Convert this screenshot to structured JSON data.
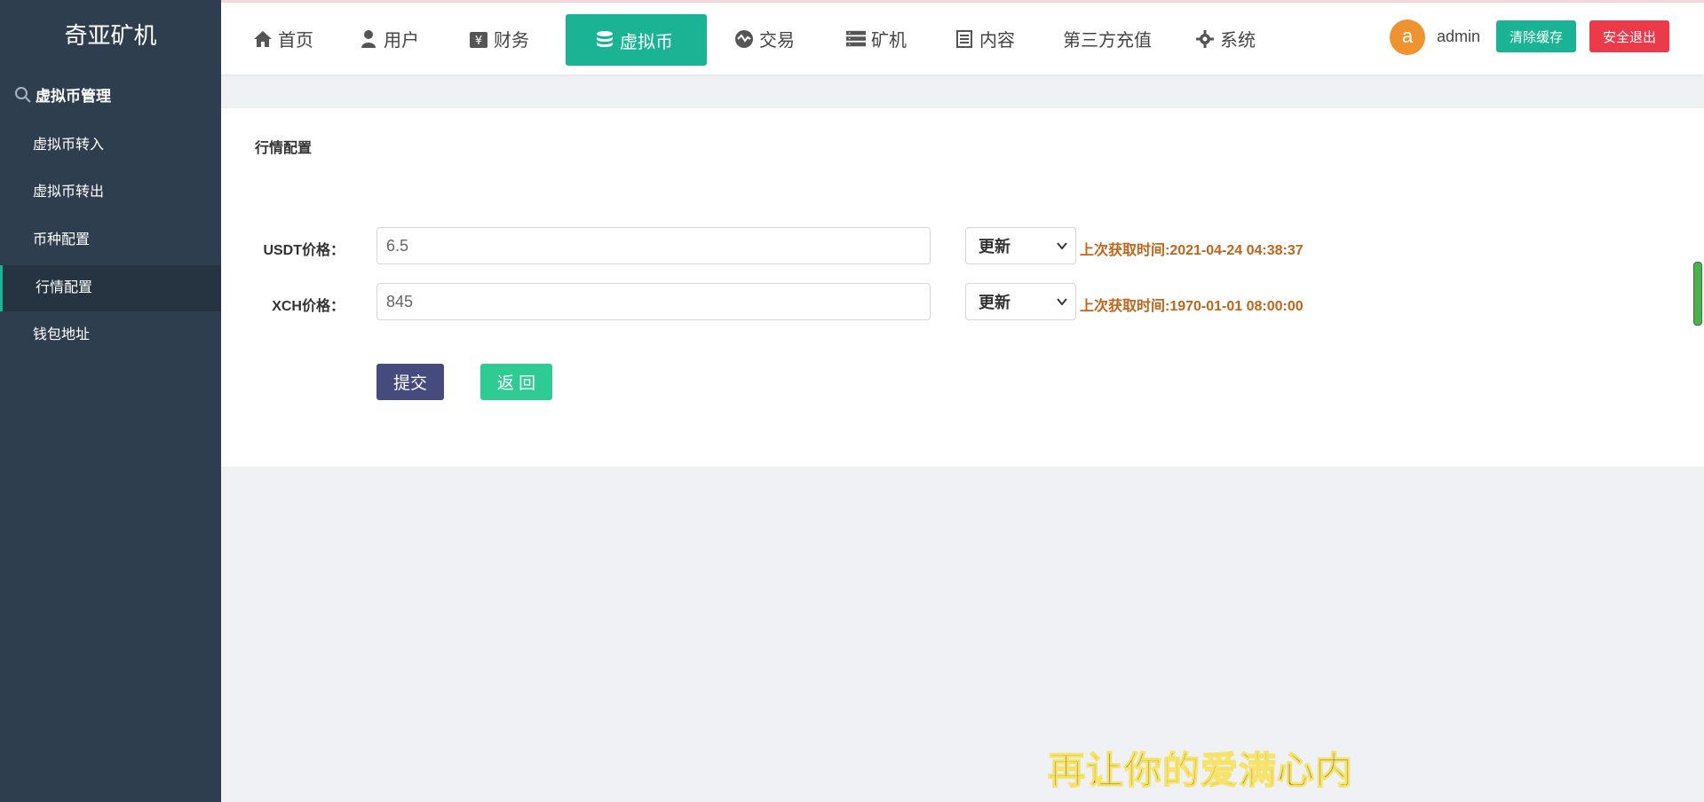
{
  "app": {
    "title": "奇亚矿机"
  },
  "sidebar": {
    "section_title": "虚拟币管理",
    "items": [
      {
        "label": "虚拟币转入"
      },
      {
        "label": "虚拟币转出"
      },
      {
        "label": "币种配置"
      },
      {
        "label": "行情配置",
        "active": true
      },
      {
        "label": "钱包地址"
      }
    ]
  },
  "nav": {
    "items": [
      {
        "label": "首页",
        "icon": "home-icon"
      },
      {
        "label": "用户",
        "icon": "user-icon"
      },
      {
        "label": "财务",
        "icon": "finance-icon"
      },
      {
        "label": "虚拟币",
        "icon": "database-icon",
        "active": true
      },
      {
        "label": "交易",
        "icon": "exchange-icon"
      },
      {
        "label": "矿机",
        "icon": "server-icon"
      },
      {
        "label": "内容",
        "icon": "document-icon"
      },
      {
        "label": "第三方充值",
        "icon": ""
      },
      {
        "label": "系统",
        "icon": "gear-icon"
      }
    ]
  },
  "user": {
    "avatar_letter": "a",
    "name": "admin",
    "clear_cache_label": "清除缓存",
    "logout_label": "安全退出"
  },
  "form": {
    "title": "行情配置",
    "rows": [
      {
        "label": "USDT价格：",
        "value": "6.5",
        "select_value": "更新",
        "last_fetch": "上次获取时间:2021-04-24 04:38:37"
      },
      {
        "label": "XCH价格：",
        "value": "845",
        "select_value": "更新",
        "last_fetch": "上次获取时间:1970-01-01 08:00:00"
      }
    ],
    "submit_label": "提交",
    "back_label": "返 回"
  },
  "overlay": {
    "subtitle": "再让你的爱满心内"
  },
  "colors": {
    "sidebar_bg": "#2f3e4e",
    "accent": "#1ab394",
    "danger": "#ed3a4b",
    "submit": "#454c7d",
    "note": "#c0641a"
  }
}
